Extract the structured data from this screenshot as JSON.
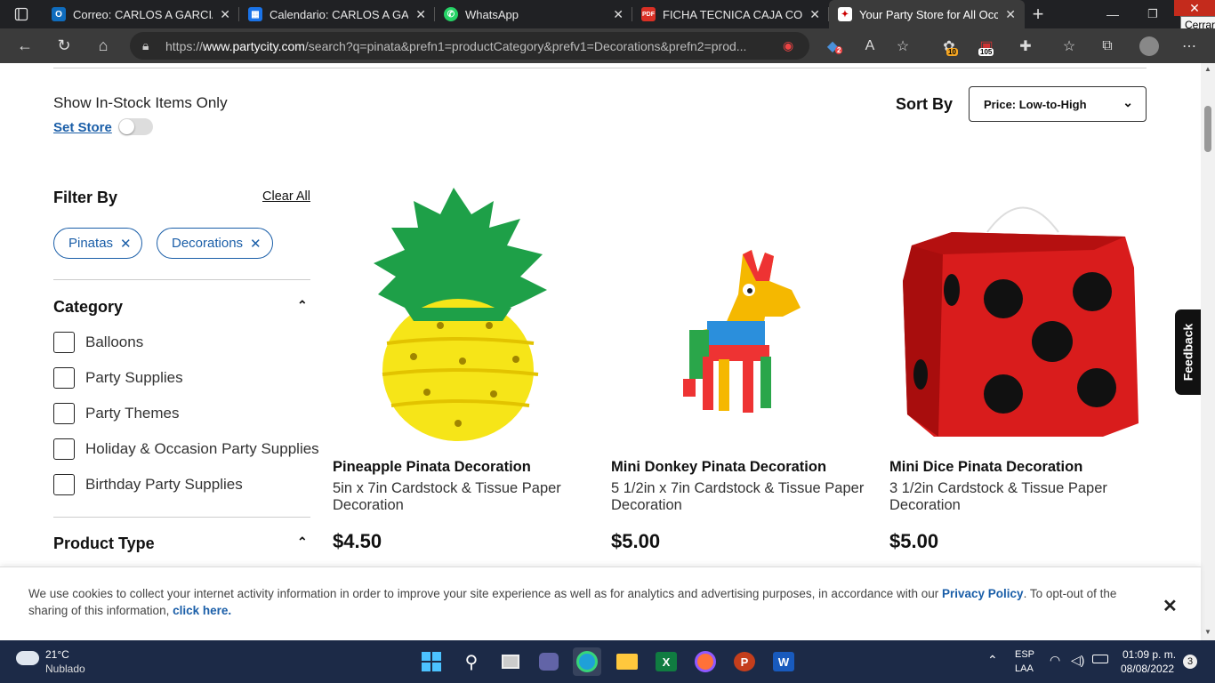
{
  "browser": {
    "tabs": [
      {
        "title": "Correo: CARLOS A GARCIA M",
        "icon": "outlook-icon",
        "color": "#0f6cbd"
      },
      {
        "title": "Calendario: CARLOS A GARCI",
        "icon": "calendar-icon",
        "color": "#1a73e8"
      },
      {
        "title": "WhatsApp",
        "icon": "whatsapp-icon",
        "color": "#25d366"
      },
      {
        "title": "FICHA TECNICA CAJA COLEC",
        "icon": "pdf-icon",
        "color": "#d93025"
      },
      {
        "title": "Your Party Store for All Occas",
        "icon": "partycity-icon",
        "color": "#ffffff"
      }
    ],
    "url_prefix": "https://",
    "url_domain": "www.partycity.com",
    "url_rest": "/search?q=pinata&prefn1=productCategory&prefv1=Decorations&prefn2=prod...",
    "close_tooltip": "Cerrar",
    "badges": {
      "collections": "2",
      "ext1": "10",
      "ext2": "105"
    }
  },
  "page": {
    "instock_label": "Show In-Stock Items Only",
    "set_store": "Set Store",
    "sort_by": "Sort By",
    "sort_value": "Price: Low-to-High",
    "filter_by": "Filter By",
    "clear_all": "Clear All",
    "chips": [
      "Pinatas",
      "Decorations"
    ],
    "category_title": "Category",
    "categories": [
      "Balloons",
      "Party Supplies",
      "Party Themes",
      "Holiday & Occasion Party Supplies",
      "Birthday Party Supplies"
    ],
    "product_type_title": "Product Type",
    "feedback": "Feedback",
    "products": [
      {
        "name": "Pineapple Pinata Decoration",
        "desc": "5in x 7in Cardstock & Tissue Paper Decoration",
        "price": "$4.50"
      },
      {
        "name": "Mini Donkey Pinata Decoration",
        "desc": "5 1/2in x 7in Cardstock & Tissue Paper Decoration",
        "price": "$5.00"
      },
      {
        "name": "Mini Dice Pinata Decoration",
        "desc": "3 1/2in Cardstock & Tissue Paper Decoration",
        "price": "$5.00"
      }
    ]
  },
  "cookie": {
    "text": "We use cookies to collect your internet activity information in order to improve your site experience as well as for analytics and advertising purposes, in accordance with our ",
    "privacy": "Privacy Policy",
    "text2": ". To opt-out of the sharing of this information, ",
    "click": "click here."
  },
  "taskbar": {
    "temp": "21°C",
    "weather": "Nublado",
    "lang1": "ESP",
    "lang2": "LAA",
    "time": "01:09 p. m.",
    "date": "08/08/2022",
    "notif_count": "3"
  }
}
